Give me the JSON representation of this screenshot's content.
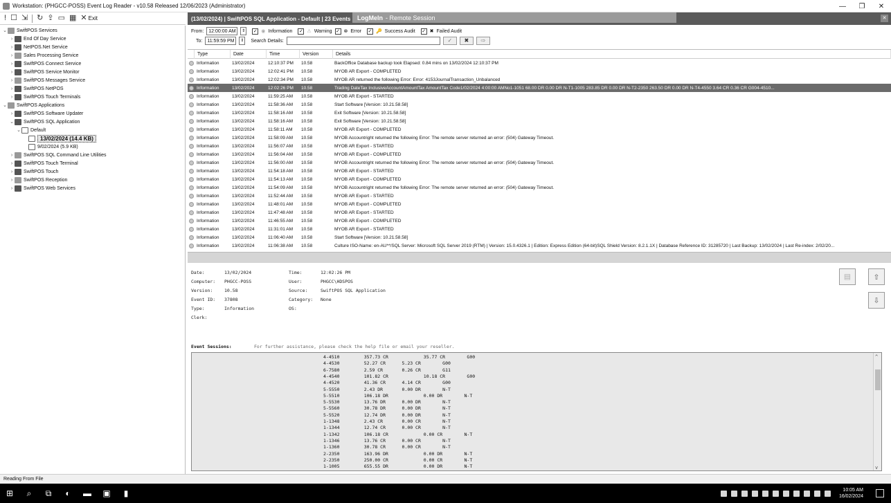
{
  "window": {
    "title": "Workstation: (PHGCC-POSS) Event Log Reader - v10.58  Released 12/06/2023 (Administrator)",
    "controls": [
      "—",
      "❐",
      "✕"
    ]
  },
  "toolbar": {
    "exit_label": "Exit"
  },
  "tree": [
    {
      "label": "SwiftPOS Services",
      "level": 0,
      "expanded": true
    },
    {
      "label": "End Of Day Service",
      "level": 1
    },
    {
      "label": "NetPOS.Net Service",
      "level": 1
    },
    {
      "label": "Sales Processing Service",
      "level": 1
    },
    {
      "label": "SwiftPOS Connect Service",
      "level": 1
    },
    {
      "label": "SwiftPOS Service Monitor",
      "level": 1
    },
    {
      "label": "SwiftPOS Messages Service",
      "level": 1
    },
    {
      "label": "SwiftPOS NetPOS",
      "level": 1
    },
    {
      "label": "SwiftPOS Touch Terminals",
      "level": 1
    },
    {
      "label": "SwiftPOS Applications",
      "level": 0,
      "expanded": true
    },
    {
      "label": "SwiftPOS Software Updater",
      "level": 1
    },
    {
      "label": "SwiftPOS SQL Application",
      "level": 1,
      "expanded": true
    },
    {
      "label": "Default",
      "level": 2,
      "expanded": true
    },
    {
      "label": "13/02/2024   (14.4 KB)",
      "level": 3,
      "selected": true
    },
    {
      "label": "9/02/2024   (5.9 KB)",
      "level": 3
    },
    {
      "label": "SwiftPOS SQL Command Line Utilities",
      "level": 1
    },
    {
      "label": "SwiftPOS Touch Terminal",
      "level": 1
    },
    {
      "label": "SwiftPOS Touch",
      "level": 1
    },
    {
      "label": "SwiftPOS Reception",
      "level": 1
    },
    {
      "label": "SwiftPOS Web Services",
      "level": 1
    }
  ],
  "session_bar": {
    "text": "(13/02/2024)   |   SwiftPOS SQL Application - Default   |   23 Events",
    "remote_brand": "LogMeIn",
    "remote_label": "- Remote Session"
  },
  "filters": {
    "from_label": "From:",
    "from_value": "12:00:00 AM",
    "to_label": "To:",
    "to_value": "11:59:59 PM",
    "search_label": "Search Details:",
    "search_value": "",
    "levels": [
      {
        "label": "Information",
        "checked": true
      },
      {
        "label": "Warning",
        "checked": true
      },
      {
        "label": "Error",
        "checked": true
      },
      {
        "label": "Success Audit",
        "checked": true
      },
      {
        "label": "Failed Audit",
        "checked": true
      }
    ]
  },
  "grid": {
    "columns": [
      "Type",
      "Date",
      "Time",
      "Version",
      "Details"
    ],
    "rows": [
      {
        "type": "Information",
        "date": "13/02/2024",
        "time": "12:10:37 PM",
        "version": "10.58",
        "details": "BackOffice Database backup took Elapsed: 0.84 mins on 13/02/2024 12:10:37 PM"
      },
      {
        "type": "Information",
        "date": "13/02/2024",
        "time": "12:02:41 PM",
        "version": "10.58",
        "details": "MYOB AR Export - COMPLETED"
      },
      {
        "type": "Information",
        "date": "13/02/2024",
        "time": "12:02:34 PM",
        "version": "10.58",
        "details": "MYOB AR returned the following Error: Error: 4153JournalTransaction_Unbalanced"
      },
      {
        "type": "Information",
        "date": "13/02/2024",
        "time": "12:02:26 PM",
        "version": "10.58",
        "details": "Trading DateTax InclusiveAccountAmountTax AmountTax Code1/02/2024 4:00:00 AMNo1-1051  68.00 DR     0.00 DR    N-T1-1005  283.85 DR     0.00 DR    N-T2-2350  263.50 DR     0.00 DR    N-T4-4550  3.64 CR     0.36 CR    G004-4510...",
        "selected": true
      },
      {
        "type": "Information",
        "date": "13/02/2024",
        "time": "11:59:25 AM",
        "version": "10.58",
        "details": "MYOB AR Export - STARTED"
      },
      {
        "type": "Information",
        "date": "13/02/2024",
        "time": "11:58:36 AM",
        "version": "10.58",
        "details": "Start Software [Version: 10.21.58.58]"
      },
      {
        "type": "Information",
        "date": "13/02/2024",
        "time": "11:58:16 AM",
        "version": "10.58",
        "details": "Exit Software [Version: 10.21.58.58]"
      },
      {
        "type": "Information",
        "date": "13/02/2024",
        "time": "11:58:16 AM",
        "version": "10.58",
        "details": "Exit Software [Version: 10.21.58.58]"
      },
      {
        "type": "Information",
        "date": "13/02/2024",
        "time": "11:58:11 AM",
        "version": "10.58",
        "details": "MYOB AR Export - COMPLETED"
      },
      {
        "type": "Information",
        "date": "13/02/2024",
        "time": "11:58:09 AM",
        "version": "10.58",
        "details": "MYOB Accountright returned the following Error: The remote server returned an error: (504) Gateway Timeout."
      },
      {
        "type": "Information",
        "date": "13/02/2024",
        "time": "11:56:07 AM",
        "version": "10.58",
        "details": "MYOB AR Export - STARTED"
      },
      {
        "type": "Information",
        "date": "13/02/2024",
        "time": "11:56:04 AM",
        "version": "10.58",
        "details": "MYOB AR Export - COMPLETED"
      },
      {
        "type": "Information",
        "date": "13/02/2024",
        "time": "11:56:00 AM",
        "version": "10.58",
        "details": "MYOB Accountright returned the following Error: The remote server returned an error: (504) Gateway Timeout."
      },
      {
        "type": "Information",
        "date": "13/02/2024",
        "time": "11:54:18 AM",
        "version": "10.58",
        "details": "MYOB AR Export - STARTED"
      },
      {
        "type": "Information",
        "date": "13/02/2024",
        "time": "11:54:13 AM",
        "version": "10.58",
        "details": "MYOB AR Export - COMPLETED"
      },
      {
        "type": "Information",
        "date": "13/02/2024",
        "time": "11:54:09 AM",
        "version": "10.58",
        "details": "MYOB Accountright returned the following Error: The remote server returned an error: (504) Gateway Timeout."
      },
      {
        "type": "Information",
        "date": "13/02/2024",
        "time": "11:52:44 AM",
        "version": "10.58",
        "details": "MYOB AR Export - STARTED"
      },
      {
        "type": "Information",
        "date": "13/02/2024",
        "time": "11:48:01 AM",
        "version": "10.58",
        "details": "MYOB AR Export - COMPLETED"
      },
      {
        "type": "Information",
        "date": "13/02/2024",
        "time": "11:47:48 AM",
        "version": "10.58",
        "details": "MYOB AR Export - STARTED"
      },
      {
        "type": "Information",
        "date": "13/02/2024",
        "time": "11:46:55 AM",
        "version": "10.58",
        "details": "MYOB AR Export - COMPLETED"
      },
      {
        "type": "Information",
        "date": "13/02/2024",
        "time": "11:31:01 AM",
        "version": "10.58",
        "details": "MYOB AR Export - STARTED"
      },
      {
        "type": "Information",
        "date": "13/02/2024",
        "time": "11:06:40 AM",
        "version": "10.58",
        "details": "Start Software [Version: 10.21.58.58]"
      },
      {
        "type": "Information",
        "date": "13/02/2024",
        "time": "11:06:38 AM",
        "version": "10.58",
        "details": "Culture ISO-Name: en-AU**/SQL Server: Microsoft SQL Server 2019 (RTM) | Version: 15.0.4326.1 | Edition: Express Edition (64-bit)SQL Shield Version: 8.2.1.1X | Database Reference ID: 31285720 | Last Backup: 13/02/2024 | Last Re-index: 2/02/20..."
      }
    ]
  },
  "detail": {
    "date_label": "Date:",
    "date": "13/02/2024",
    "time_label": "Time:",
    "time": "12:02:26 PM",
    "computer_label": "Computer:",
    "computer": "PHGCC-POSS",
    "user_label": "User:",
    "user": "PHGCC\\HDSPOS",
    "version_label": "Version:",
    "version": "10.58",
    "source_label": "Source:",
    "source": "SwiftPOS SQL Application",
    "event_id_label": "Event ID:",
    "event_id": "37808",
    "category_label": "Category:",
    "category": "None",
    "type_label": "Type:",
    "type": "Information",
    "os_label": "OS:",
    "os": "",
    "clerk_label": "Clerk:",
    "clerk": ""
  },
  "sessions": {
    "label": "Event Sessions:",
    "hint": "For further assistance, please check the help file or email your reseller.",
    "lines": [
      "4-4510         357.73 CR             35.77 CR        G00",
      "4-4530         52.27 CR      5.23 CR        G00",
      "6-7580         2.59 CR       0.26 CR        G11",
      "4-4540         101.82 CR             10.18 CR        G00",
      "4-4520         41.36 CR      4.14 CR        G00",
      "5-5550         2.43 DR       0.00 DR        N-T",
      "5-5510         106.18 DR             0.00 DR        N-T",
      "5-5530         13.76 DR      0.00 DR        N-T",
      "5-5560         30.78 DR      0.00 DR        N-T",
      "5-5520         12.74 DR      0.00 DR        N-T",
      "1-1348         2.43 CR       0.00 CR        N-T",
      "1-1344         12.74 CR      0.00 CR        N-T",
      "1-1342         106.18 CR             0.00 CR        N-T",
      "1-1346         13.76 CR      0.00 CR        N-T",
      "1-1360         30.78 CR      0.00 CR        N-T",
      "2-2350         163.96 DR             0.00 DR        N-T",
      "2-2350         250.00 CR             0.00 CR        N-T",
      "1-1005         655.55 DR             0.00 DR        N-T"
    ]
  },
  "status": {
    "text": "Reading From File"
  },
  "taskbar": {
    "time": "10:05 AM",
    "date": "16/02/2024"
  }
}
